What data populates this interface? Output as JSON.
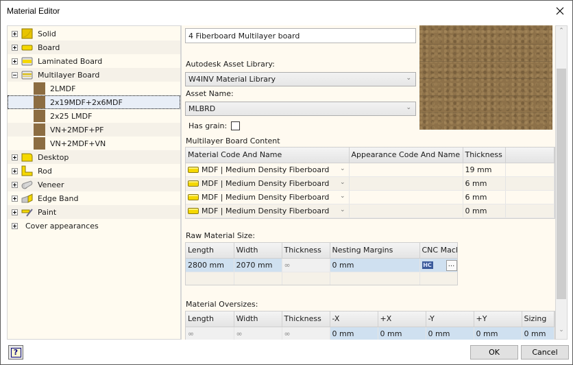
{
  "window": {
    "title": "Material Editor"
  },
  "tree": {
    "categories": [
      {
        "label": "Solid",
        "icon": "solid-block-icon",
        "expanded": false
      },
      {
        "label": "Board",
        "icon": "board-icon",
        "expanded": false
      },
      {
        "label": "Laminated Board",
        "icon": "laminated-board-icon",
        "expanded": false
      },
      {
        "label": "Multilayer Board",
        "icon": "multilayer-board-icon",
        "expanded": true,
        "children": [
          "2LMDF",
          "2x19MDF+2x6MDF",
          "2x25 LMDF",
          "VN+2MDF+PF",
          "VN+2MDF+VN"
        ],
        "selected_child": "2x19MDF+2x6MDF"
      },
      {
        "label": "Desktop",
        "icon": "desktop-icon",
        "expanded": false
      },
      {
        "label": "Rod",
        "icon": "rod-icon",
        "expanded": false
      },
      {
        "label": "Veneer",
        "icon": "veneer-icon",
        "expanded": false
      },
      {
        "label": "Edge Band",
        "icon": "edge-band-icon",
        "expanded": false
      },
      {
        "label": "Paint",
        "icon": "paint-icon",
        "expanded": false
      },
      {
        "label": "Cover appearances",
        "icon": null,
        "expanded": false
      }
    ]
  },
  "details": {
    "name_value": "4 Fiberboard Multilayer board",
    "asset_library_label": "Autodesk Asset Library:",
    "asset_library_value": "W4INV Material Library",
    "asset_name_label": "Asset Name:",
    "asset_name_value": "MLBRD",
    "has_grain_label": "Has grain:",
    "has_grain_checked": false,
    "content_label": "Multilayer Board Content",
    "content_columns": [
      "Material Code And Name",
      "Appearance Code And Name",
      "Thickness"
    ],
    "content_rows": [
      {
        "material": "MDF | Medium Density Fiberboard",
        "appearance": "",
        "thickness": "19 mm"
      },
      {
        "material": "MDF | Medium Density Fiberboard",
        "appearance": "",
        "thickness": "6 mm"
      },
      {
        "material": "MDF | Medium Density Fiberboard",
        "appearance": "",
        "thickness": "6 mm"
      },
      {
        "material": "MDF | Medium Density Fiberboard",
        "appearance": "",
        "thickness": "0 mm"
      }
    ],
    "raw_label": "Raw Material Size:",
    "raw_columns": [
      "Length",
      "Width",
      "Thickness",
      "Nesting Margins",
      "CNC Macl"
    ],
    "raw_row": {
      "length": "2800 mm",
      "width": "2070 mm",
      "thickness": "∞",
      "nesting": "0 mm",
      "cnc_icon": "HC",
      "browse": "..."
    },
    "oversize_label": "Material Oversizes:",
    "oversize_columns": [
      "Length",
      "Width",
      "Thickness",
      "-X",
      "+X",
      "-Y",
      "+Y",
      "Sizing"
    ],
    "oversize_row": [
      "∞",
      "∞",
      "∞",
      "0 mm",
      "0 mm",
      "0 mm",
      "0 mm",
      "0 mm"
    ]
  },
  "buttons": {
    "ok": "OK",
    "cancel": "Cancel",
    "help": "?"
  }
}
